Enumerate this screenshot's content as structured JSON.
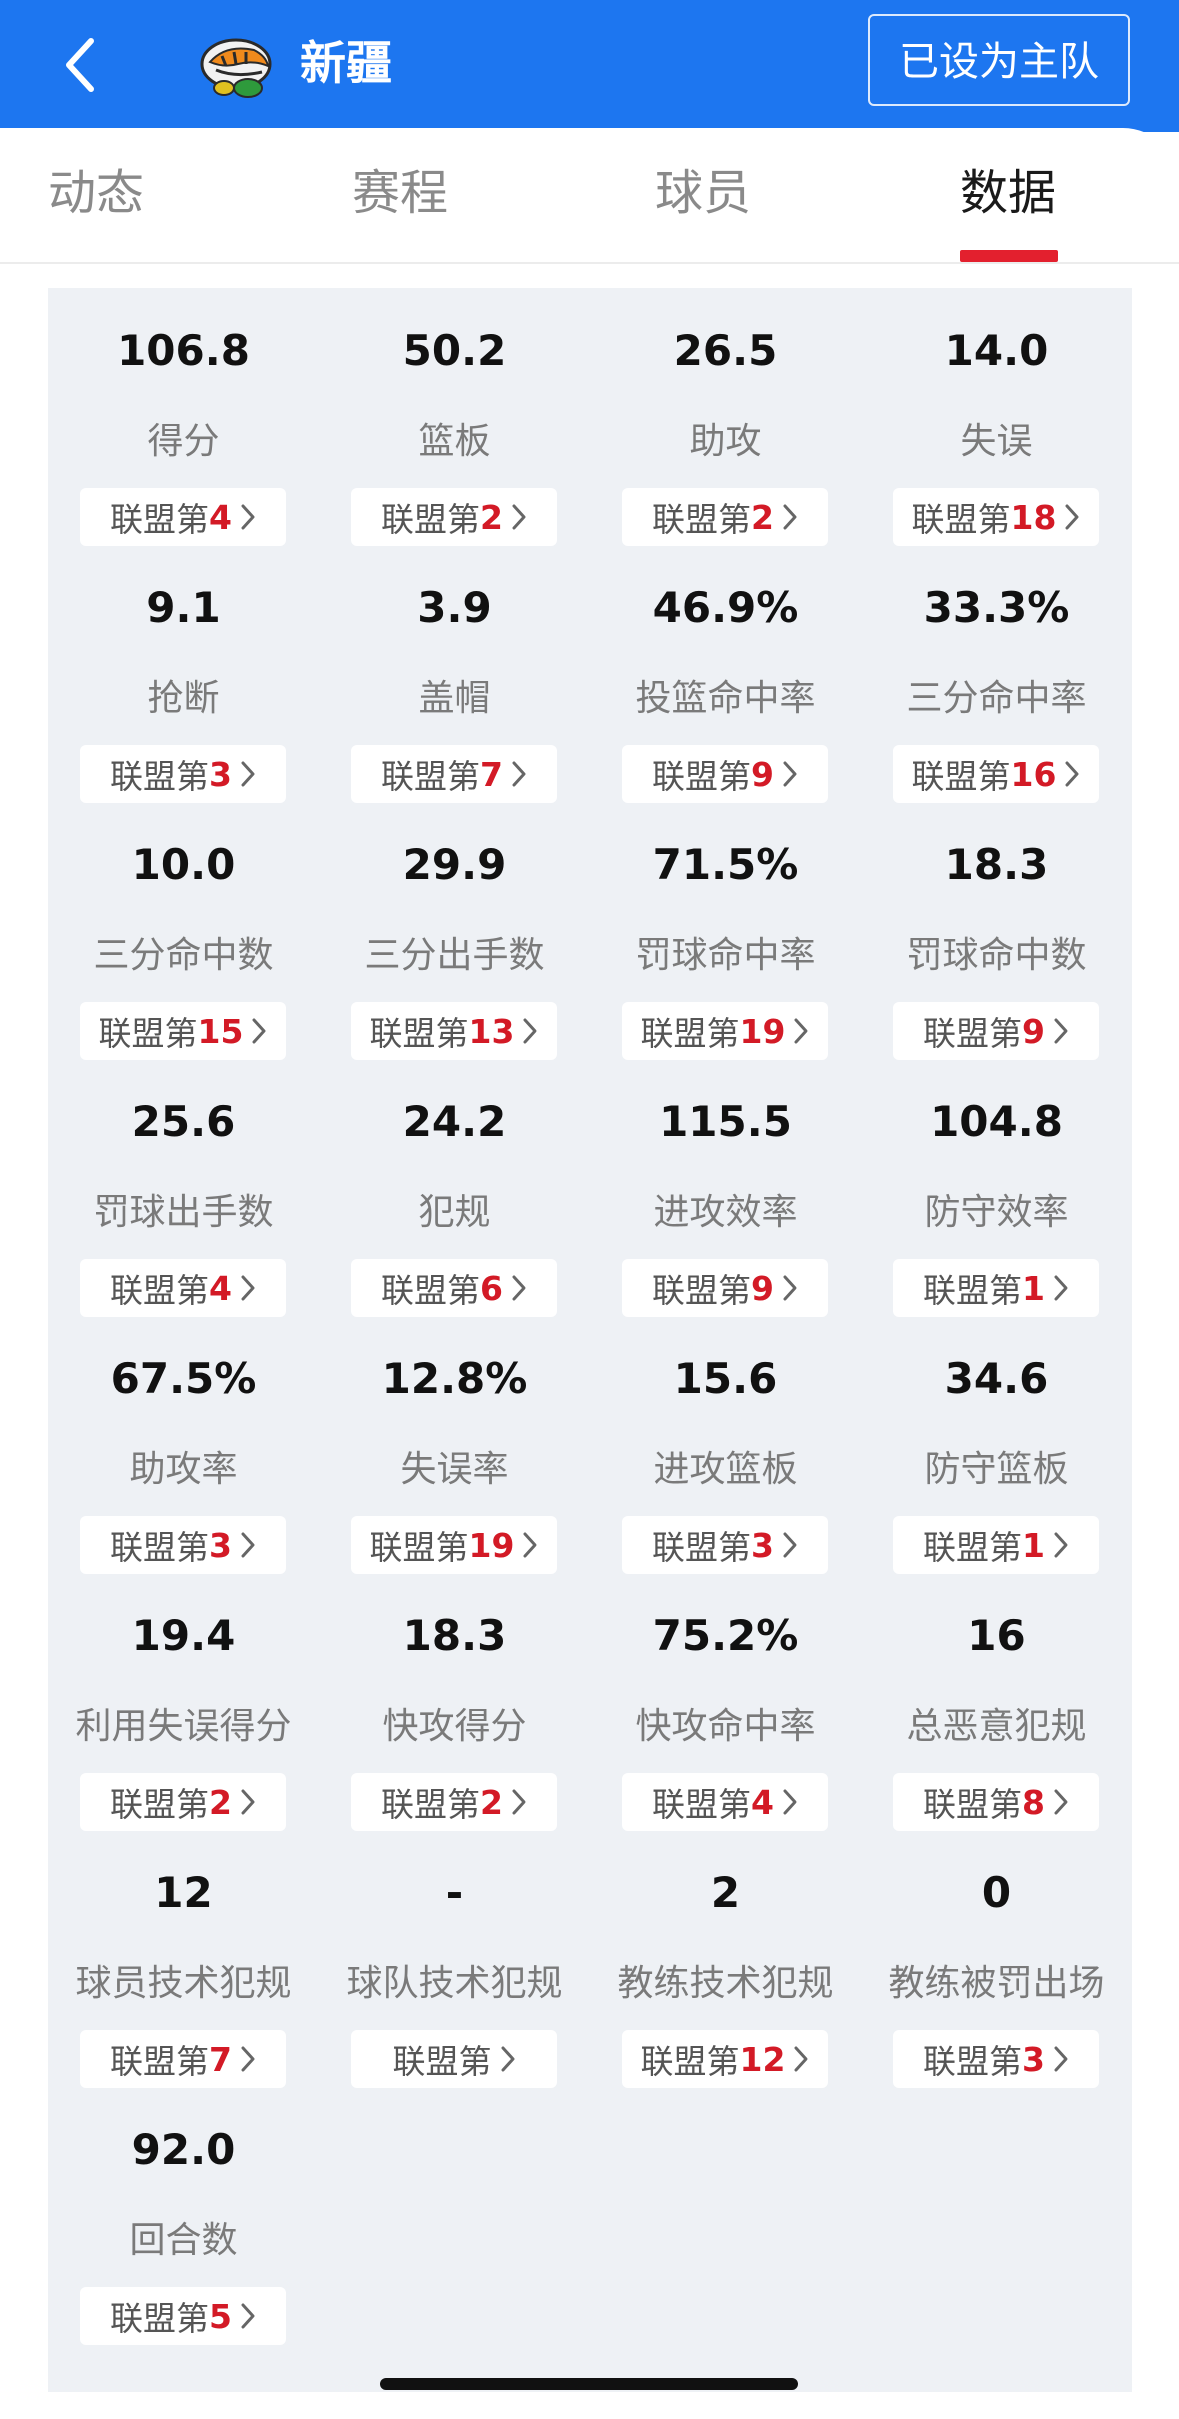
{
  "header": {
    "team_name": "新疆",
    "home_team_button": "已设为主队",
    "colors": {
      "bar": "#1d76f0",
      "accent": "#e3202e",
      "rank_number": "#d31a26"
    }
  },
  "tabs": [
    {
      "label": "动态"
    },
    {
      "label": "赛程"
    },
    {
      "label": "球员"
    },
    {
      "label": "数据"
    }
  ],
  "active_tab": "数据",
  "rank_prefix": "联盟第",
  "stats": [
    {
      "value": "106.8",
      "label": "得分",
      "rank": "4"
    },
    {
      "value": "50.2",
      "label": "篮板",
      "rank": "2"
    },
    {
      "value": "26.5",
      "label": "助攻",
      "rank": "2"
    },
    {
      "value": "14.0",
      "label": "失误",
      "rank": "18"
    },
    {
      "value": "9.1",
      "label": "抢断",
      "rank": "3"
    },
    {
      "value": "3.9",
      "label": "盖帽",
      "rank": "7"
    },
    {
      "value": "46.9%",
      "label": "投篮命中率",
      "rank": "9"
    },
    {
      "value": "33.3%",
      "label": "三分命中率",
      "rank": "16"
    },
    {
      "value": "10.0",
      "label": "三分命中数",
      "rank": "15"
    },
    {
      "value": "29.9",
      "label": "三分出手数",
      "rank": "13"
    },
    {
      "value": "71.5%",
      "label": "罚球命中率",
      "rank": "19"
    },
    {
      "value": "18.3",
      "label": "罚球命中数",
      "rank": "9"
    },
    {
      "value": "25.6",
      "label": "罚球出手数",
      "rank": "4"
    },
    {
      "value": "24.2",
      "label": "犯规",
      "rank": "6"
    },
    {
      "value": "115.5",
      "label": "进攻效率",
      "rank": "9"
    },
    {
      "value": "104.8",
      "label": "防守效率",
      "rank": "1"
    },
    {
      "value": "67.5%",
      "label": "助攻率",
      "rank": "3"
    },
    {
      "value": "12.8%",
      "label": "失误率",
      "rank": "19"
    },
    {
      "value": "15.6",
      "label": "进攻篮板",
      "rank": "3"
    },
    {
      "value": "34.6",
      "label": "防守篮板",
      "rank": "1"
    },
    {
      "value": "19.4",
      "label": "利用失误得分",
      "rank": "2"
    },
    {
      "value": "18.3",
      "label": "快攻得分",
      "rank": "2"
    },
    {
      "value": "75.2%",
      "label": "快攻命中率",
      "rank": "4"
    },
    {
      "value": "16",
      "label": "总恶意犯规",
      "rank": "8"
    },
    {
      "value": "12",
      "label": "球员技术犯规",
      "rank": "7"
    },
    {
      "value": "-",
      "label": "球队技术犯规",
      "rank": ""
    },
    {
      "value": "2",
      "label": "教练技术犯规",
      "rank": "12"
    },
    {
      "value": "0",
      "label": "教练被罚出场",
      "rank": "3"
    },
    {
      "value": "92.0",
      "label": "回合数",
      "rank": "5"
    }
  ]
}
